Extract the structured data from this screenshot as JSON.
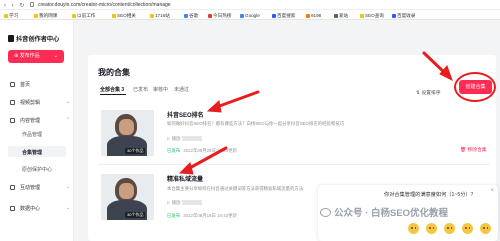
{
  "browser": {
    "url": "creator.douyin.com/creator-micro/content/collection/manage",
    "bookmarks": [
      "学习",
      "我的网课",
      "以前工作",
      "SEO相关",
      "1716站",
      "谷歌",
      "今日热榜",
      "Google",
      "百度搜索",
      "9198",
      "爱站",
      "SEO查询",
      "百度收录"
    ]
  },
  "sidebar": {
    "brand": "抖音创作者中心",
    "publish_label": "发布作品",
    "items": [
      {
        "label": "首页"
      },
      {
        "label": "视频剪辑"
      },
      {
        "label": "内容管理"
      },
      {
        "label": "互动管理"
      },
      {
        "label": "数据中心"
      }
    ],
    "subitems": [
      "作品管理",
      "合集管理",
      "原创保护中心"
    ]
  },
  "main": {
    "title": "我的合集",
    "tabs": [
      "全部合集 3",
      "已发布",
      "审核中",
      "未通过"
    ],
    "sort_label": "设置排序",
    "create_button": "创建合集",
    "collections": [
      {
        "name": "抖音SEO排名",
        "description": "如何做好抖音SEO排名？都有哪些方法？白杨SEO与你一起分享抖音SEO排名的经验和技巧",
        "count_badge": "30个作品",
        "stats": "播放",
        "status": "已发布",
        "meta": "2022年08月29日 10:24更新",
        "remove": "移除合集"
      },
      {
        "name": "精准私域流量",
        "description": "本合集主要分享如何在抖音通过关键词等方法获得精准私域流量的方法",
        "count_badge": "30个作品",
        "stats": "播放",
        "status": "已发布",
        "meta": "2022年08月18日 16:43更新",
        "remove": "移除合集"
      }
    ]
  },
  "survey": {
    "question": "你对合集管理的满意度如何（1~5分）？"
  },
  "watermark": "公众号 · 白杨SEO优化教程",
  "colors": {
    "accent": "#fe2c55",
    "annotation": "#e81e1e",
    "published": "#25c36a"
  }
}
